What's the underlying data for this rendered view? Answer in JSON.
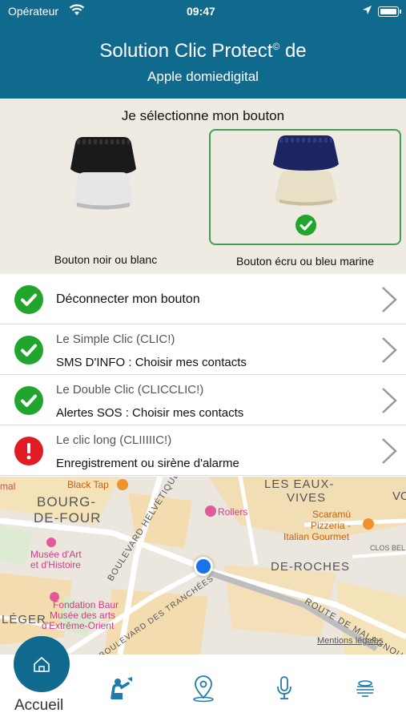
{
  "status": {
    "carrier": "Opérateur",
    "time": "09:47"
  },
  "header": {
    "title": "Solution Clic Protect",
    "title_mark": "©",
    "title_suffix": " de",
    "subtitle": "Apple  domiedigital"
  },
  "selector": {
    "title": "Je sélectionne mon bouton",
    "options": [
      {
        "label": "Bouton noir ou blanc",
        "selected": false
      },
      {
        "label": "Bouton écru ou bleu marine",
        "selected": true
      }
    ]
  },
  "list": [
    {
      "status": "ok",
      "line1": "",
      "line2": "Déconnecter mon bouton"
    },
    {
      "status": "ok",
      "line1": "Le Simple Clic (CLIC!)",
      "line2": "SMS D'INFO : Choisir mes contacts"
    },
    {
      "status": "ok",
      "line1": "Le Double Clic (CLICCLIC!)",
      "line2": "Alertes SOS : Choisir mes contacts"
    },
    {
      "status": "error",
      "line1": "Le clic long (CLIIIIIC!)",
      "line2": "Enregistrement ou sirène d'alarme"
    }
  ],
  "map": {
    "labels": {
      "bourg1": "BOURG-",
      "bourg2": "DE-FOUR",
      "eaux1": "LES EAUX-",
      "eaux2": "VIVES",
      "roches": "DE-ROCHES",
      "leger": "LÉGER",
      "blacktap": "Black Tap",
      "rollers": "Rollers",
      "scaramu1": "Scaramù",
      "scaramu2": "Pizzeria -",
      "scaramu3": "Italian Gourmet",
      "musee1": "Musée d'Art",
      "musee2": "et d'Histoire",
      "baur1": "Fondation Baur",
      "baur2": "Musée des arts",
      "baur3": "d'Extrême-Orient",
      "blvd_helv": "BOULEVARD HELVÉTIQUE",
      "blvd_tranch": "BOULEVARD DES TRANCHÉES",
      "route": "ROUTE DE MALAGNOU",
      "vo": "VO",
      "clos": "CLOS BEL",
      "mal": "mal"
    },
    "legal": "Mentions légales"
  },
  "tabbar": {
    "home_label": "Accueil"
  },
  "colors": {
    "primary": "#106a8e",
    "ok": "#21a52c",
    "error": "#e01b24",
    "selected_border": "#3fa34d"
  }
}
